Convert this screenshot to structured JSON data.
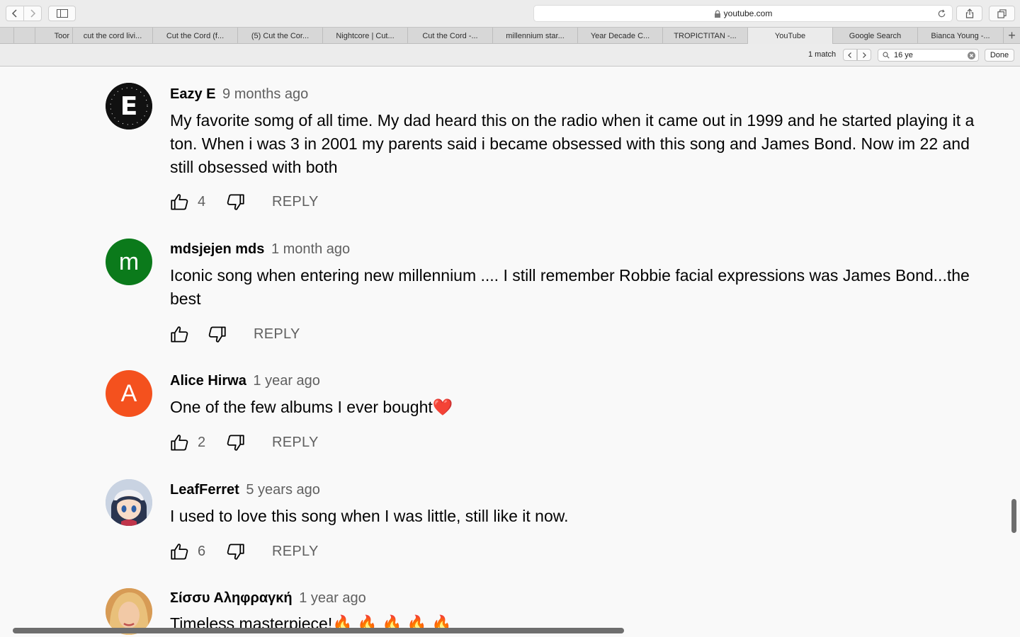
{
  "browser": {
    "url": "youtube.com",
    "tabs": [
      {
        "label": "Toor"
      },
      {
        "label": "cut the cord livi..."
      },
      {
        "label": "Cut the Cord (f..."
      },
      {
        "label": "(5) Cut the Cor..."
      },
      {
        "label": "Nightcore | Cut..."
      },
      {
        "label": "Cut the Cord -..."
      },
      {
        "label": "millennium star..."
      },
      {
        "label": "Year Decade C..."
      },
      {
        "label": "TROPICTITAN -..."
      },
      {
        "label": "YouTube",
        "active": true
      },
      {
        "label": "Google Search"
      },
      {
        "label": "Bianca Young -..."
      }
    ],
    "new_tab_label": "+"
  },
  "find": {
    "match_count": "1 match",
    "query": "16 ye",
    "done_label": "Done"
  },
  "comments": [
    {
      "author": "Eazy E",
      "time": "9 months ago",
      "text": "My favorite somg of all time. My dad heard this on the radio when it came out in 1999 and he started playing it a ton. When i was 3 in 2001 my parents said i became obsessed with this song and James Bond. Now im 22 and still obsessed with both",
      "likes": "4",
      "reply_label": "REPLY",
      "avatar_letter": "E",
      "avatar_color": "#111111"
    },
    {
      "author": "mdsjejen mds",
      "time": "1 month ago",
      "text": "Iconic song when entering new millennium .... I still remember Robbie facial expressions was James Bond...the best",
      "likes": "",
      "reply_label": "REPLY",
      "avatar_letter": "m",
      "avatar_color": "#0b7a1b"
    },
    {
      "author": "Alice Hirwa",
      "time": "1 year ago",
      "text": "One of the few albums I ever bought",
      "text_emoji": "❤️",
      "likes": "2",
      "reply_label": "REPLY",
      "avatar_letter": "A",
      "avatar_color": "#f4511e"
    },
    {
      "author": "LeafFerret",
      "time": "5 years ago",
      "text": "I used to love this song when I was little, still like it now.",
      "likes": "6",
      "reply_label": "REPLY",
      "avatar_color": "#b9c6d8"
    },
    {
      "author": "Σίσσυ Αληφραγκή",
      "time": "1 year ago",
      "text": "Timeless masterpiece!",
      "text_emoji": "🔥 🔥 🔥 🔥 🔥",
      "avatar_color": "#e8b87d"
    }
  ]
}
